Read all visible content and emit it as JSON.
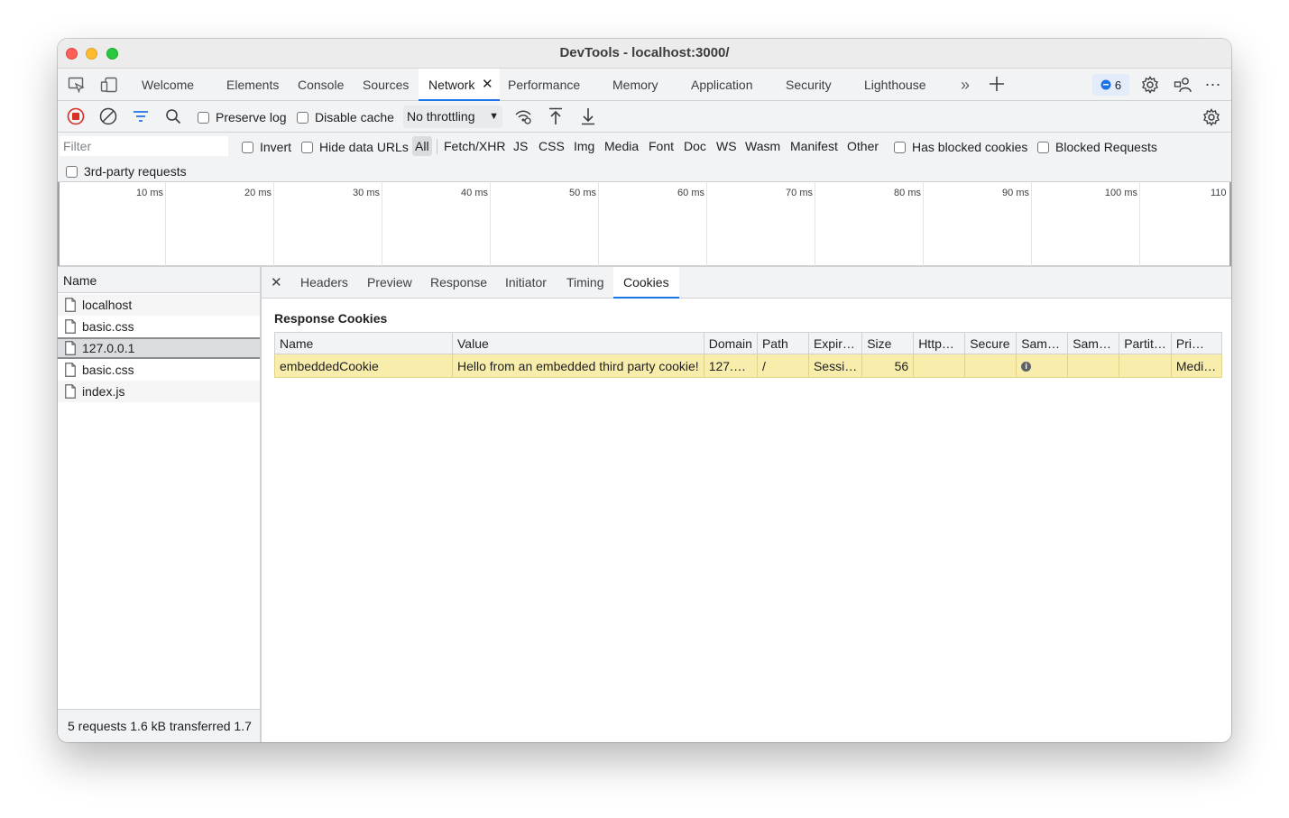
{
  "window": {
    "title": "DevTools - localhost:3000/"
  },
  "tabs": [
    {
      "label": "Welcome"
    },
    {
      "label": "Elements"
    },
    {
      "label": "Console"
    },
    {
      "label": "Sources"
    },
    {
      "label": "Network"
    },
    {
      "label": "Performance"
    },
    {
      "label": "Memory"
    },
    {
      "label": "Application"
    },
    {
      "label": "Security"
    },
    {
      "label": "Lighthouse"
    }
  ],
  "issues_badge": {
    "count": "6"
  },
  "toolbar": {
    "preserve_log": "Preserve log",
    "disable_cache": "Disable cache",
    "throttling": "No throttling"
  },
  "filter": {
    "placeholder": "Filter",
    "invert": "Invert",
    "hide_data_urls": "Hide data URLs",
    "types": [
      "All",
      "Fetch/XHR",
      "JS",
      "CSS",
      "Img",
      "Media",
      "Font",
      "Doc",
      "WS",
      "Wasm",
      "Manifest",
      "Other"
    ],
    "has_blocked_cookies": "Has blocked cookies",
    "blocked_requests": "Blocked Requests",
    "third_party": "3rd-party requests"
  },
  "timeline": {
    "ticks": [
      "10 ms",
      "20 ms",
      "30 ms",
      "40 ms",
      "50 ms",
      "60 ms",
      "70 ms",
      "80 ms",
      "90 ms",
      "100 ms",
      "110"
    ]
  },
  "requests": {
    "header": "Name",
    "items": [
      "localhost",
      "basic.css",
      "127.0.0.1",
      "basic.css",
      "index.js"
    ],
    "summary": "5 requests   1.6 kB transferred   1.7"
  },
  "details": {
    "tabs": [
      "Headers",
      "Preview",
      "Response",
      "Initiator",
      "Timing",
      "Cookies"
    ],
    "section_title": "Response Cookies",
    "columns": [
      "Name",
      "Value",
      "Domain",
      "Path",
      "Expir…",
      "Size",
      "Http…",
      "Secure",
      "Sam…",
      "Sam…",
      "Partit…",
      "Pri…"
    ],
    "row": {
      "name": "embeddedCookie",
      "value": "Hello from an embedded third party cookie!",
      "domain": "127.…",
      "path": "/",
      "expires": "Sessi…",
      "size": "56",
      "priority": "Medi…"
    }
  },
  "colors": {
    "accent": "#1a73e8",
    "row_highlight": "#f8edaa",
    "record_red": "#d93025"
  }
}
